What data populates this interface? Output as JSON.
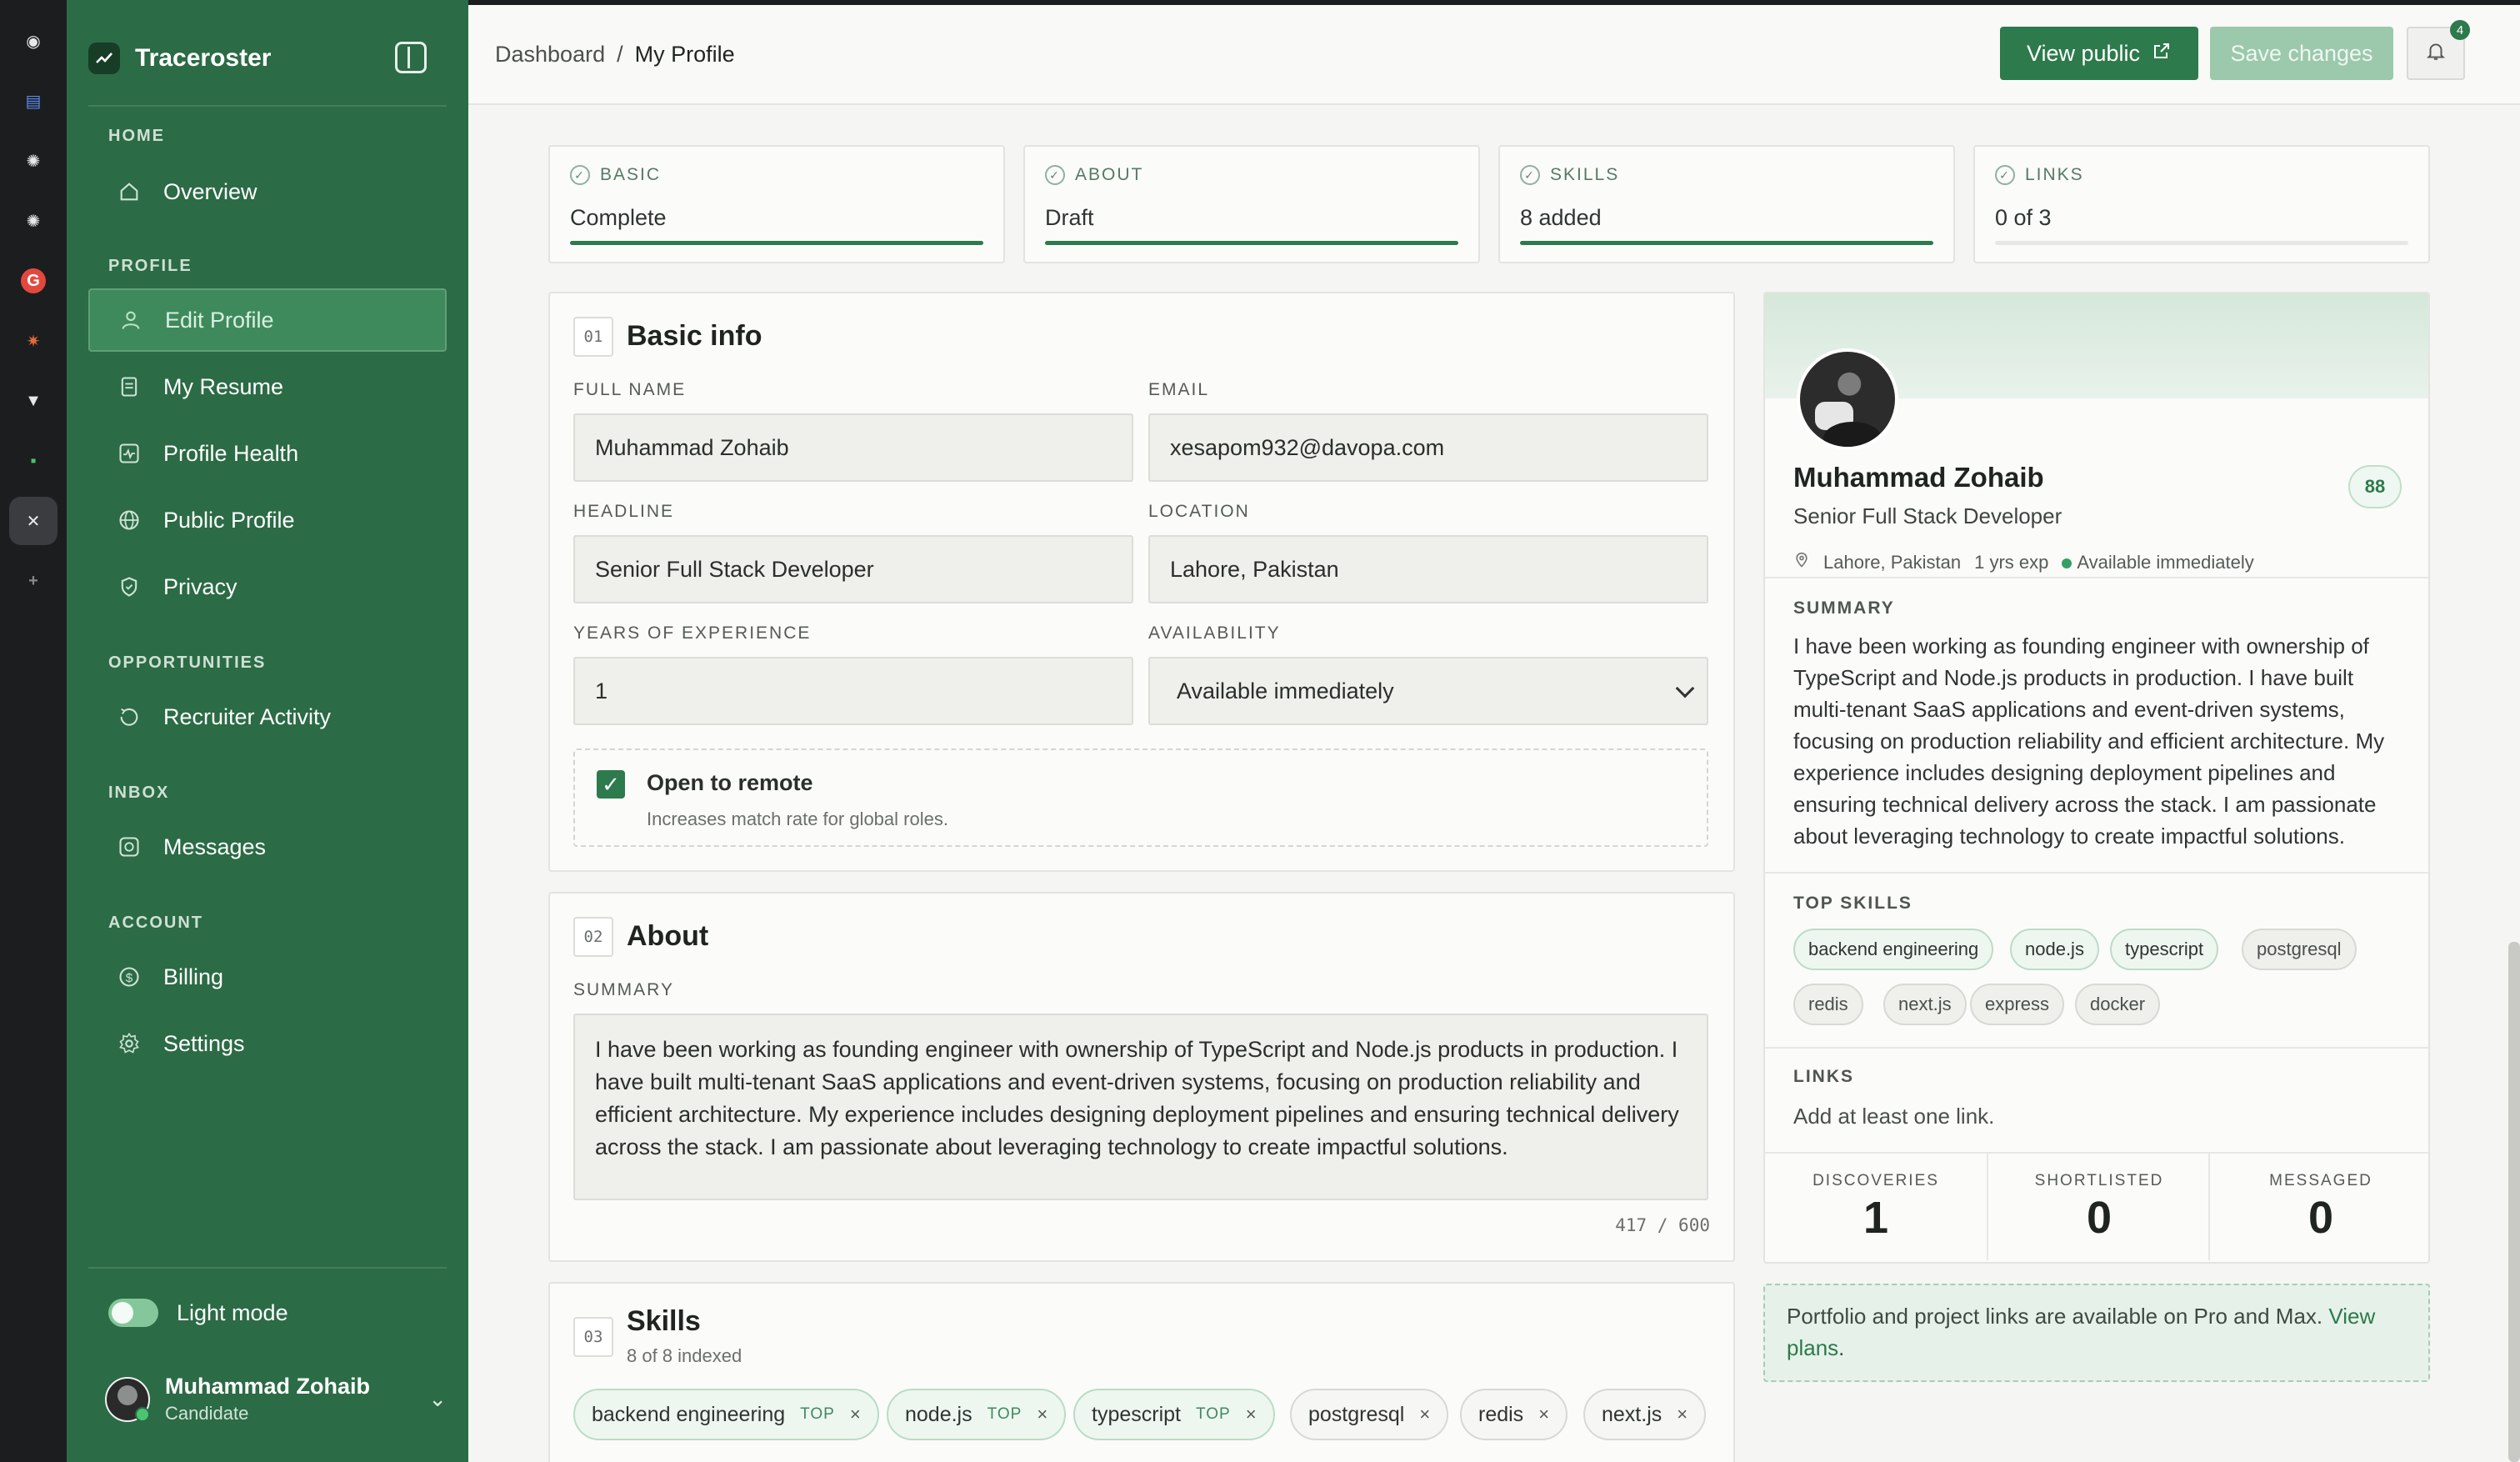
{
  "dock": {
    "items": [
      {
        "name": "github",
        "glyph": "◉"
      },
      {
        "name": "trello",
        "glyph": "▤"
      },
      {
        "name": "openai-1",
        "glyph": "✺"
      },
      {
        "name": "openai-2",
        "glyph": "✺"
      },
      {
        "name": "grammarly",
        "glyph": "G"
      },
      {
        "name": "claude",
        "glyph": "✷"
      },
      {
        "name": "app-v",
        "glyph": "▼"
      },
      {
        "name": "app-dots",
        "glyph": "▪"
      },
      {
        "name": "close",
        "glyph": "✕"
      },
      {
        "name": "add",
        "glyph": "+"
      }
    ],
    "colors": {
      "grammarly": "#e2483d",
      "claude": "#e06c3c",
      "trello": "#5b8df0"
    }
  },
  "sidebar": {
    "brand": "Traceroster",
    "sections": [
      {
        "label": "HOME",
        "items": [
          {
            "label": "Overview",
            "icon": "home-icon"
          }
        ]
      },
      {
        "label": "PROFILE",
        "items": [
          {
            "label": "Edit Profile",
            "icon": "user-icon",
            "active": true
          },
          {
            "label": "My Resume",
            "icon": "document-icon"
          },
          {
            "label": "Profile Health",
            "icon": "pulse-icon"
          },
          {
            "label": "Public Profile",
            "icon": "globe-icon"
          },
          {
            "label": "Privacy",
            "icon": "shield-icon"
          }
        ]
      },
      {
        "label": "OPPORTUNITIES",
        "items": [
          {
            "label": "Recruiter Activity",
            "icon": "activity-icon"
          }
        ]
      },
      {
        "label": "INBOX",
        "items": [
          {
            "label": "Messages",
            "icon": "message-icon"
          }
        ]
      },
      {
        "label": "ACCOUNT",
        "items": [
          {
            "label": "Billing",
            "icon": "dollar-icon"
          },
          {
            "label": "Settings",
            "icon": "gear-icon"
          }
        ]
      }
    ],
    "mode_label": "Light mode",
    "user": {
      "name": "Muhammad Zohaib",
      "role": "Candidate"
    }
  },
  "topbar": {
    "breadcrumb": [
      "Dashboard",
      "My Profile"
    ],
    "view_public": "View public",
    "save_changes": "Save changes",
    "notifications": "4"
  },
  "progress": [
    {
      "label": "BASIC",
      "value": "Complete",
      "fill": 1.0
    },
    {
      "label": "ABOUT",
      "value": "Draft",
      "fill": 1.0
    },
    {
      "label": "SKILLS",
      "value": "8 added",
      "fill": 1.0
    },
    {
      "label": "LINKS",
      "value": "0 of 3",
      "fill": 0.0
    }
  ],
  "basic": {
    "num": "01",
    "title": "Basic info",
    "full_name_label": "FULL NAME",
    "full_name": "Muhammad Zohaib",
    "email_label": "EMAIL",
    "email": "xesapom932@davopa.com",
    "headline_label": "HEADLINE",
    "headline": "Senior Full Stack Developer",
    "location_label": "LOCATION",
    "location": "Lahore, Pakistan",
    "years_label": "YEARS OF EXPERIENCE",
    "years": "1",
    "availability_label": "AVAILABILITY",
    "availability": "Available immediately",
    "remote_label": "Open to remote",
    "remote_hint": "Increases match rate for global roles."
  },
  "about": {
    "num": "02",
    "title": "About",
    "summary_label": "SUMMARY",
    "summary": "I have been working as founding engineer with ownership of TypeScript and Node.js products in production. I have built multi-tenant SaaS applications and event-driven systems, focusing on production reliability and efficient architecture. My experience includes designing deployment pipelines and ensuring technical delivery across the stack. I am passionate about leveraging technology to create impactful solutions.",
    "counter": "417 / 600"
  },
  "skills": {
    "num": "03",
    "title": "Skills",
    "subtitle": "8 of 8 indexed",
    "top_tag": "TOP",
    "remove": "×",
    "chips": [
      "backend engineering",
      "node.js",
      "typescript",
      "postgresql",
      "redis",
      "next.js"
    ]
  },
  "preview": {
    "name": "Muhammad Zohaib",
    "role": "Senior Full Stack Developer",
    "score": "88",
    "location": "Lahore, Pakistan",
    "exp": "1 yrs exp",
    "availability": "Available immediately",
    "summary_head": "SUMMARY",
    "summary": "I have been working as founding engineer with ownership of TypeScript and Node.js products in production. I have built multi-tenant SaaS applications and event-driven systems, focusing on production reliability and efficient architecture. My experience includes designing deployment pipelines and ensuring technical delivery across the stack. I am passionate about leveraging technology to create impactful solutions.",
    "skills_head": "TOP SKILLS",
    "skills": [
      "backend engineering",
      "node.js",
      "typescript",
      "postgresql",
      "redis",
      "next.js",
      "express",
      "docker"
    ],
    "links_head": "LINKS",
    "links_text": "Add at least one link.",
    "stats": [
      {
        "label": "DISCOVERIES",
        "value": "1"
      },
      {
        "label": "SHORTLISTED",
        "value": "0"
      },
      {
        "label": "MESSAGED",
        "value": "0"
      }
    ]
  },
  "upsell": {
    "text": "Portfolio and project links are available on Pro and Max.",
    "link": "View plans",
    "end": "."
  },
  "colors": {
    "accent": "#2d7a4c",
    "sidebar": "#2b6b45",
    "active_nav": "#3f8a5c"
  }
}
